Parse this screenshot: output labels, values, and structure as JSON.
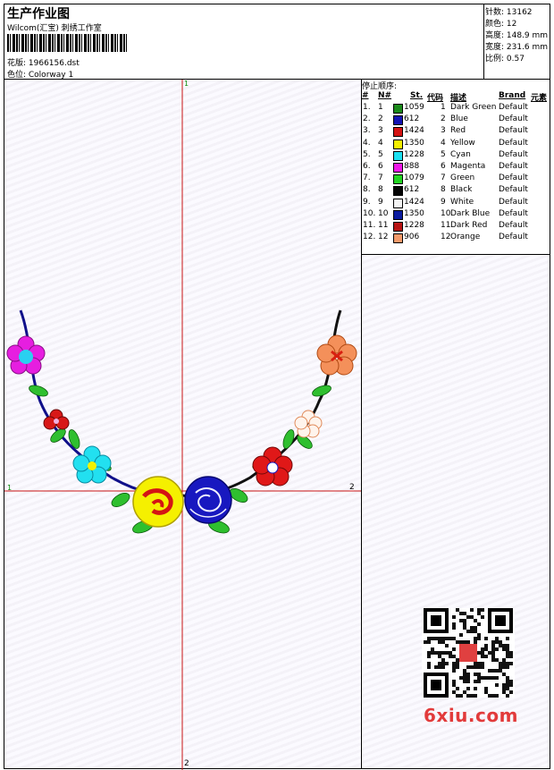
{
  "header": {
    "title": "生产作业图",
    "subtitle": "Wilcom(汇宝) 刺绣工作室",
    "design_label": "花版: 1966156.dst",
    "colorway_label": "色位: Colorway 1"
  },
  "stats": {
    "stitches": "针数: 13162",
    "colors": "颜色: 12",
    "height": "高度: 148.9 mm",
    "width": "宽度: 231.6 mm",
    "scale": "比例: 0.57"
  },
  "canvas": {
    "axis_top": "1",
    "axis_left": "1",
    "axis_right": "2",
    "axis_bottom": "2"
  },
  "legend": {
    "title": "停止顺序:",
    "columns": [
      "#",
      "N#",
      "St.",
      "代码",
      "描述",
      "Brand",
      "元素"
    ],
    "rows": [
      {
        "idx": "1.",
        "n": "1",
        "st": "1059",
        "code": "1",
        "desc": "Dark Green",
        "brand": "Default",
        "color": "#1a8a1a"
      },
      {
        "idx": "2.",
        "n": "2",
        "st": "612",
        "code": "2",
        "desc": "Blue",
        "brand": "Default",
        "color": "#1414b4"
      },
      {
        "idx": "3.",
        "n": "3",
        "st": "1424",
        "code": "3",
        "desc": "Red",
        "brand": "Default",
        "color": "#d41414"
      },
      {
        "idx": "4.",
        "n": "4",
        "st": "1350",
        "code": "4",
        "desc": "Yellow",
        "brand": "Default",
        "color": "#f5f000"
      },
      {
        "idx": "5.",
        "n": "5",
        "st": "1228",
        "code": "5",
        "desc": "Cyan",
        "brand": "Default",
        "color": "#1ce0f0"
      },
      {
        "idx": "6.",
        "n": "6",
        "st": "888",
        "code": "6",
        "desc": "Magenta",
        "brand": "Default",
        "color": "#f018e8"
      },
      {
        "idx": "7.",
        "n": "7",
        "st": "1079",
        "code": "7",
        "desc": "Green",
        "brand": "Default",
        "color": "#22d422"
      },
      {
        "idx": "8.",
        "n": "8",
        "st": "612",
        "code": "8",
        "desc": "Black",
        "brand": "Default",
        "color": "#050505"
      },
      {
        "idx": "9.",
        "n": "9",
        "st": "1424",
        "code": "9",
        "desc": "White",
        "brand": "Default",
        "color": "#f4f4f4"
      },
      {
        "idx": "10.",
        "n": "10",
        "st": "1350",
        "code": "10",
        "desc": "Dark Blue",
        "brand": "Default",
        "color": "#0c1ca0"
      },
      {
        "idx": "11.",
        "n": "11",
        "st": "1228",
        "code": "11",
        "desc": "Dark Red",
        "brand": "Default",
        "color": "#b81414"
      },
      {
        "idx": "12.",
        "n": "12",
        "st": "906",
        "code": "12",
        "desc": "Orange",
        "brand": "Default",
        "color": "#f49a6a"
      }
    ]
  },
  "watermark": "6xiu.com"
}
